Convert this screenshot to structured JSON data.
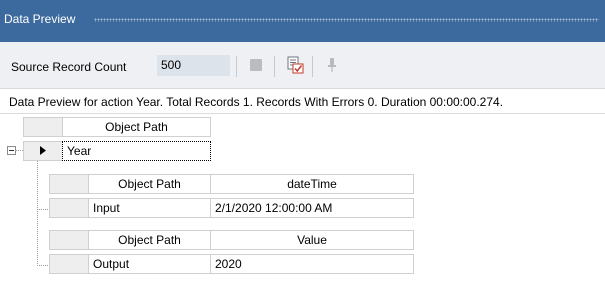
{
  "window": {
    "title": "Data Preview"
  },
  "toolbar": {
    "record_count_label": "Source Record Count",
    "record_count_value": "500",
    "icons": [
      "stop-icon",
      "preview-check-icon",
      "pin-icon"
    ]
  },
  "status": {
    "message": "Data Preview for action Year. Total Records 1. Records With Errors 0. Duration 00:00:00.274."
  },
  "grid": {
    "root_header": "Object Path",
    "root_row": {
      "value": "Year"
    },
    "children": [
      {
        "headers": [
          "Object Path",
          "dateTime"
        ],
        "row": [
          "Input",
          "2/1/2020 12:00:00 AM"
        ]
      },
      {
        "headers": [
          "Object Path",
          "Value"
        ],
        "row": [
          "Output",
          "2020"
        ]
      }
    ]
  },
  "colors": {
    "titlebar": "#3c6a9e",
    "toolbar": "#eef0f3",
    "input_bg": "#dde3ea"
  }
}
